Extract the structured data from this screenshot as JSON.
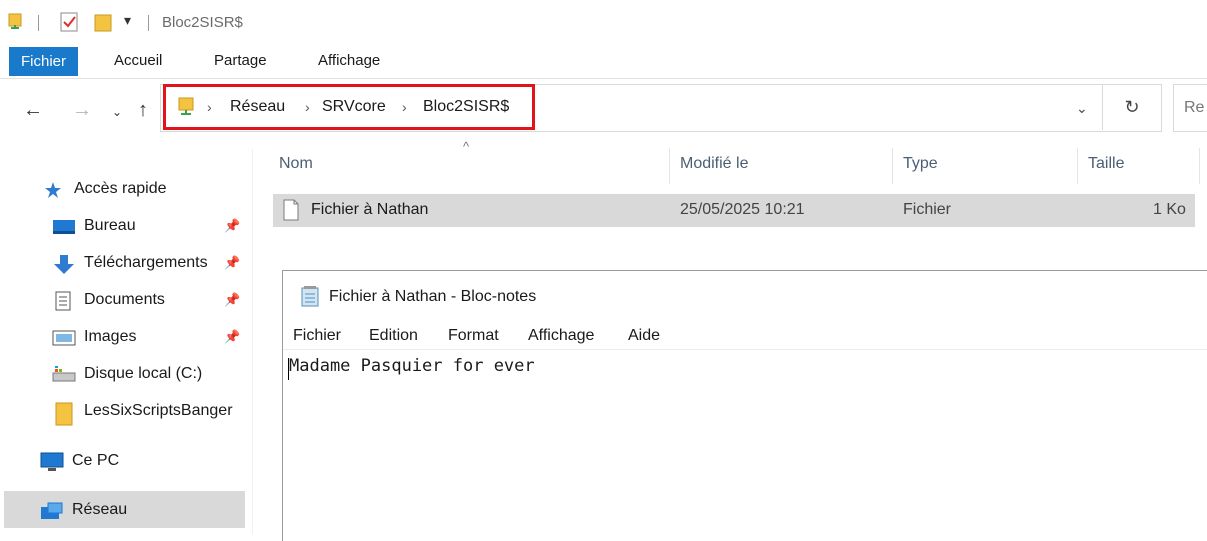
{
  "window": {
    "title": "Bloc2SISR$"
  },
  "ribbon": {
    "tabs": [
      "Fichier",
      "Accueil",
      "Partage",
      "Affichage"
    ]
  },
  "address": {
    "crumbs": [
      "Réseau",
      "SRVcore",
      "Bloc2SISR$"
    ],
    "search_placeholder": "Re"
  },
  "sidebar": {
    "quick_access": "Accès rapide",
    "items": [
      "Bureau",
      "Téléchargements",
      "Documents",
      "Images",
      "Disque local (C:)",
      "LesSixScriptsBanger"
    ],
    "this_pc": "Ce PC",
    "network": "Réseau"
  },
  "columns": [
    "Nom",
    "Modifié le",
    "Type",
    "Taille"
  ],
  "files": [
    {
      "name": "Fichier à Nathan",
      "modified": "25/05/2025 10:21",
      "type": "Fichier",
      "size": "1 Ko"
    }
  ],
  "notepad": {
    "title": "Fichier à Nathan - Bloc-notes",
    "menu": [
      "Fichier",
      "Edition",
      "Format",
      "Affichage",
      "Aide"
    ],
    "content": "Madame Pasquier for ever"
  },
  "colors": {
    "accent": "#1979ca",
    "highlight_border": "#e2141b",
    "selected_row": "#d9d9d9"
  }
}
